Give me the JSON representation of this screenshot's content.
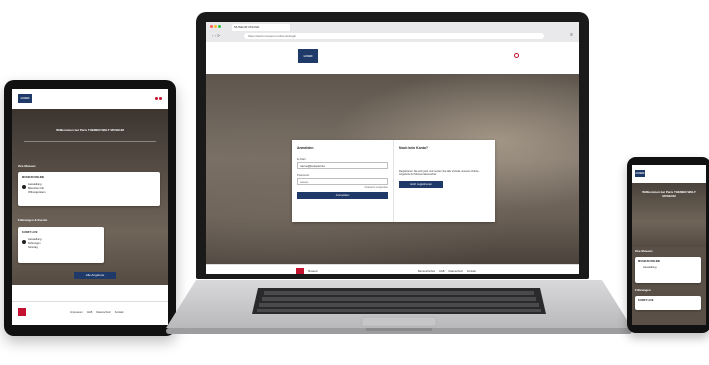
{
  "tablet": {
    "logo": "LOGO",
    "hero_title": "Willkommen bei Paris THEMEN WELT MUSEUM",
    "section_museums": "Ihre Museen",
    "card1": {
      "title": "MUSEUM ONLINE",
      "line1": "Ausstellung",
      "line2": "Besucher Info",
      "line3": "Öffnungszeiten"
    },
    "section_tours": "Führungen & Events",
    "card2": {
      "title": "KUNST LIVE",
      "line1": "Ausstellung",
      "line2": "Führungen",
      "line3": "Sonntag"
    },
    "cta_button": "Alle Angebote",
    "footer_links": [
      "Impressum",
      "AGB",
      "Datenschutz",
      "Kontakt"
    ]
  },
  "laptop": {
    "tab_title": "MUSEUM ONLINE",
    "url": "https://www.museum-online.de/login",
    "logo": "LOGO",
    "login": {
      "heading_left": "Anmelden",
      "email_label": "E-Mail",
      "email_value": "name@beispiel.de",
      "password_label": "Passwort",
      "password_value": "••••••••",
      "forgot": "Passwort vergessen",
      "submit": "Anmelden",
      "heading_right": "Noch kein Konto?",
      "register_text": "Registrieren Sie sich jetzt und nutzen Sie alle Vorteile unseres Online-Angebots für Museumsbesucher.",
      "register_button": "Jetzt registrieren"
    },
    "footer_logo": "LOGO",
    "footer_name": "Museum",
    "footer_links": [
      "Barrierefreiheit",
      "AGB",
      "Datenschutz",
      "Kontakt"
    ]
  },
  "phone": {
    "logo": "LOGO",
    "hero_title": "Willkommen bei Paris THEMEN WELT MUSEUM",
    "section": "Ihre Museen",
    "card_title": "MUSEUM ONLINE",
    "card_line": "Ausstellung",
    "section2": "Führungen",
    "card2_title": "KUNST LIVE"
  },
  "colors": {
    "navy": "#1f3a68",
    "red": "#c4112f"
  }
}
